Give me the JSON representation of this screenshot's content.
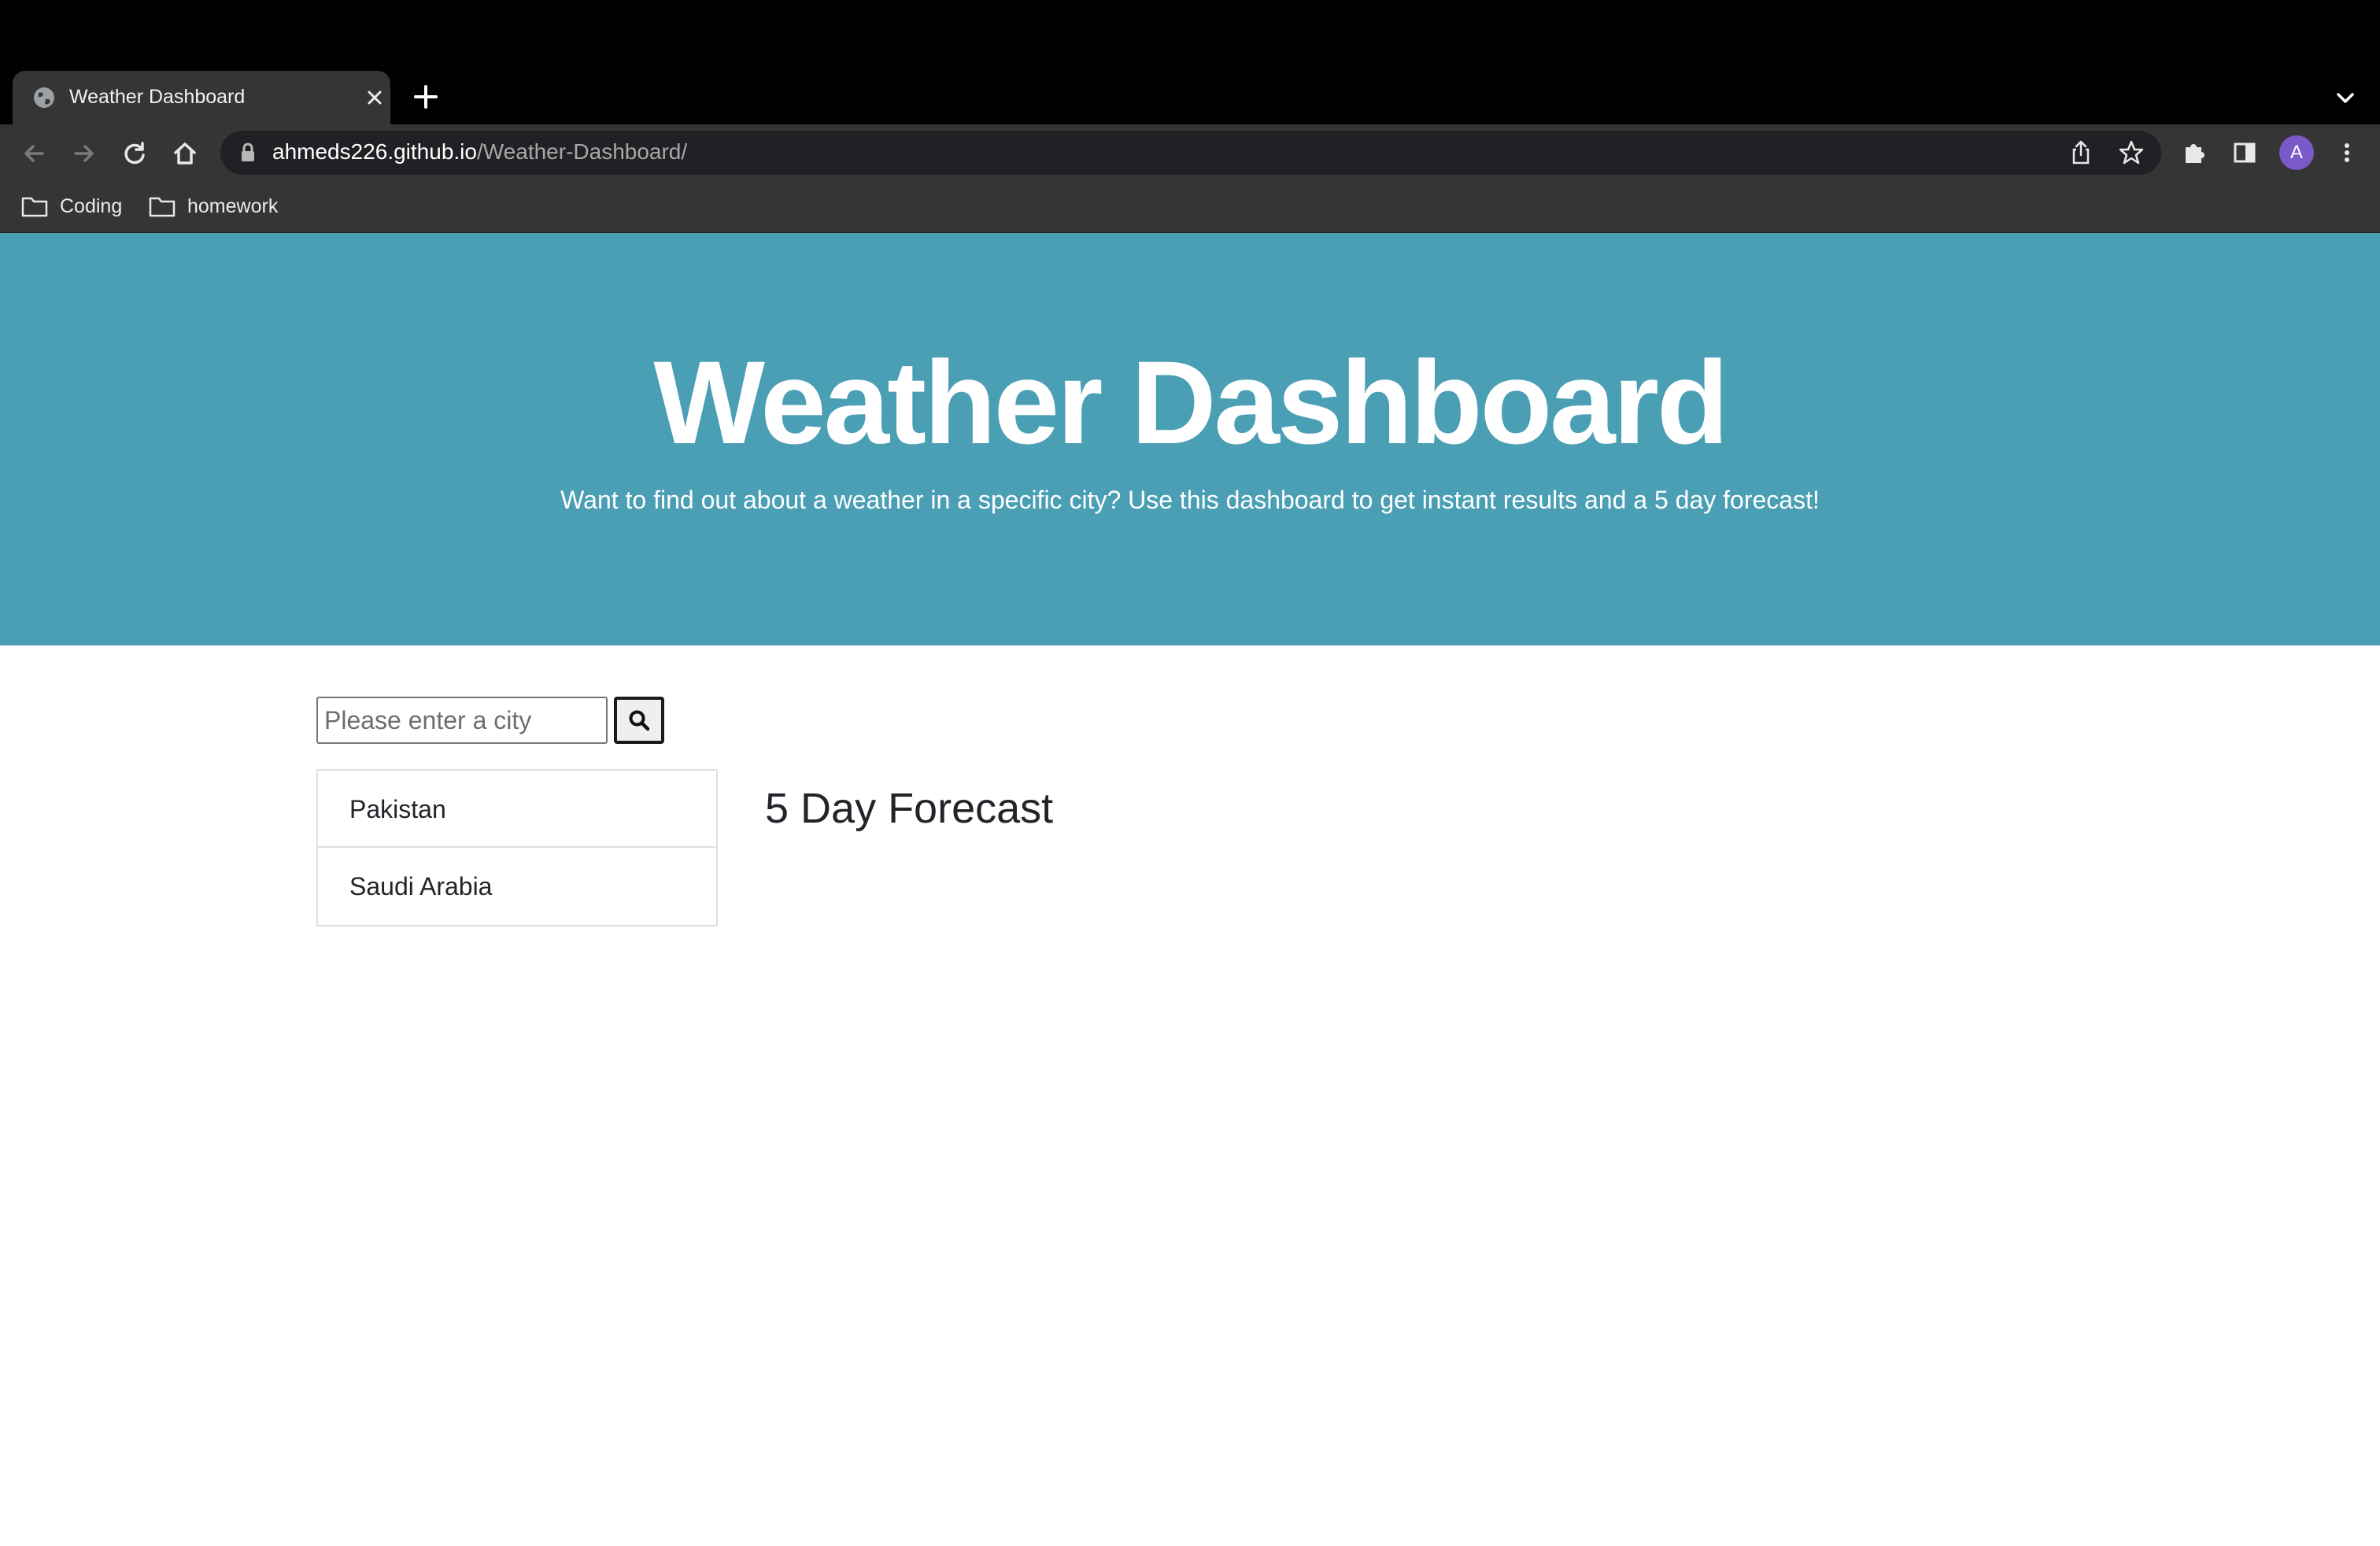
{
  "browser": {
    "tab_title": "Weather Dashboard",
    "url_host": "ahmeds226.github.io",
    "url_path": "/Weather-Dashboard/",
    "profile_initial": "A",
    "bookmarks": [
      {
        "label": "Coding",
        "icon": "folder-icon"
      },
      {
        "label": "homework",
        "icon": "folder-icon"
      }
    ]
  },
  "hero": {
    "title": "Weather Dashboard",
    "subtitle": "Want to find out about a weather in a specific city? Use this dashboard to get instant results and a 5 day forecast!",
    "background": "#4a9fb5"
  },
  "search": {
    "placeholder": "Please enter a city",
    "value": "",
    "button_icon": "search-icon"
  },
  "history": {
    "items": [
      "Pakistan",
      "Saudi Arabia"
    ]
  },
  "forecast": {
    "title": "5 Day Forecast"
  }
}
